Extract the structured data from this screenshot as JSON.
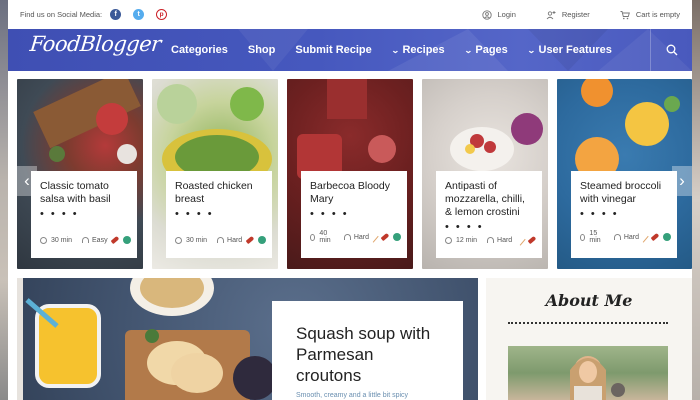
{
  "topbar": {
    "social_label": "Find us on Social Media:",
    "social": [
      "f",
      "t",
      "p"
    ],
    "login": "Login",
    "register": "Register",
    "cart": "Cart is empty"
  },
  "nav": {
    "logo": "FoodBlogger",
    "items": [
      {
        "label": "Categories",
        "chevron": false
      },
      {
        "label": "Shop",
        "chevron": false
      },
      {
        "label": "Submit Recipe",
        "chevron": false
      },
      {
        "label": "Recipes",
        "chevron": true
      },
      {
        "label": "Pages",
        "chevron": true
      },
      {
        "label": "User Features",
        "chevron": true
      }
    ],
    "search_icon": "search-icon"
  },
  "cards": [
    {
      "title": "Classic tomato salsa with basil",
      "time": "30 min",
      "level": "Easy",
      "tags": [
        "chili",
        "leaf"
      ]
    },
    {
      "title": "Roasted chicken breast",
      "time": "30 min",
      "level": "Hard",
      "tags": [
        "chili",
        "leaf"
      ]
    },
    {
      "title": "Barbecoa Bloody Mary",
      "time": "40 min",
      "level": "Hard",
      "tags": [
        "wheat",
        "chili",
        "leaf"
      ]
    },
    {
      "title": "Antipasti of mozzarella, chilli, & lemon crostini",
      "time": "12 min",
      "level": "Hard",
      "tags": [
        "wheat",
        "chili"
      ]
    },
    {
      "title": "Steamed broccoli with vinegar",
      "time": "15 min",
      "level": "Hard",
      "tags": [
        "wheat",
        "chili",
        "leaf"
      ]
    }
  ],
  "dots": "• • • •",
  "slider": {
    "prev": "‹",
    "next": "›"
  },
  "featured": {
    "title": "Squash soup with Parmesan croutons",
    "subtitle": "Smooth, creamy and a little bit spicy"
  },
  "about": {
    "title": "About Me"
  },
  "colors": {
    "nav": "#4658be",
    "chili": "#c0392b",
    "leaf": "#35a07b",
    "wheat": "#e0a66b"
  }
}
